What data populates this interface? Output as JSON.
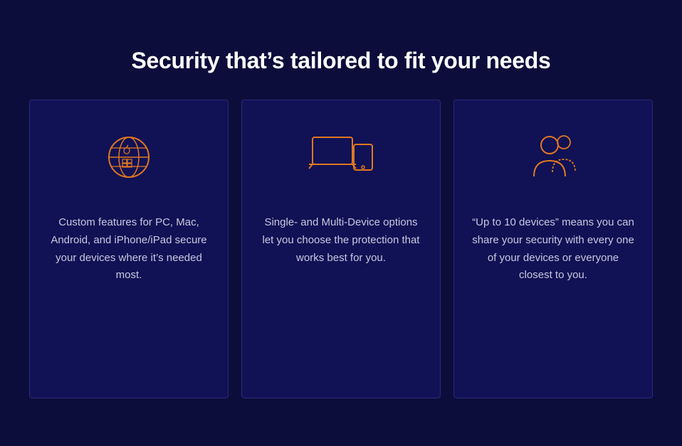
{
  "page": {
    "title": "Security that’s tailored to fit your needs",
    "background_color": "#0d0d3b"
  },
  "cards": [
    {
      "id": "card-1",
      "icon_name": "devices-icon",
      "text": "Custom features for PC, Mac, Android, and iPhone/iPad secure your devices where it’s needed most."
    },
    {
      "id": "card-2",
      "icon_name": "multi-device-icon",
      "text": "Single- and Multi-Device options let you choose the protection that works best for you."
    },
    {
      "id": "card-3",
      "icon_name": "family-share-icon",
      "text": "“Up to 10 devices” means you can share your security with every one of your devices or everyone closest to you."
    }
  ]
}
